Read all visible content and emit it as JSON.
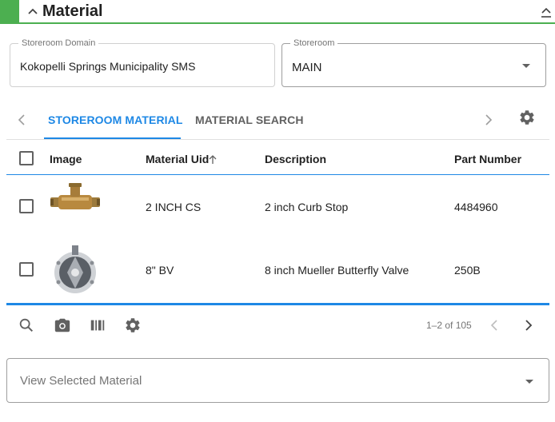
{
  "section": {
    "title": "Material",
    "accent_color": "#4caf50",
    "expand_icon": "chevron-up-icon",
    "collapse_icon": "collapse-icon"
  },
  "storeroom_domain": {
    "label": "Storeroom Domain",
    "value": "Kokopelli Springs Municipality SMS"
  },
  "storeroom": {
    "label": "Storeroom",
    "value": "MAIN"
  },
  "tabs": {
    "items": [
      {
        "label": "STOREROOM MATERIAL",
        "active": true
      },
      {
        "label": "MATERIAL SEARCH",
        "active": false
      }
    ],
    "accent_color": "#1e88e5"
  },
  "table": {
    "columns": [
      "Image",
      "Material Uid",
      "Description",
      "Part Number"
    ],
    "sorted_column": "Material Uid",
    "sort_direction": "ascending",
    "rows": [
      {
        "image": "curb-stop-image",
        "material_uid": "2 INCH CS",
        "description": "2 inch Curb Stop",
        "part_number": "4484960"
      },
      {
        "image": "butterfly-valve-image",
        "material_uid": "8\" BV",
        "description": "8 inch Mueller Butterfly Valve",
        "part_number": "250B"
      }
    ]
  },
  "toolbar": {
    "icons": [
      "search-icon",
      "camera-icon",
      "barcode-icon",
      "settings-icon"
    ],
    "pagination": "1–2 of 105"
  },
  "view_selected": {
    "placeholder": "View Selected Material"
  }
}
